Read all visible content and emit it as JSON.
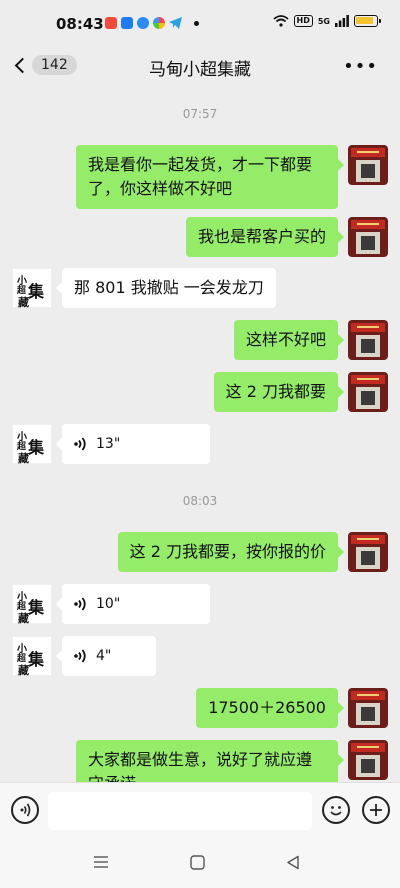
{
  "status_bar": {
    "time": "08:43",
    "hd_label": "HD",
    "signal_label": "5G",
    "icons": [
      "app-red-icon",
      "app-blue-icon",
      "app-shield-icon",
      "app-colorful-icon",
      "telegram-icon",
      "notification-dot-icon",
      "wifi-icon",
      "signal-icon",
      "battery-icon"
    ]
  },
  "header": {
    "unread_count": "142",
    "title": "马甸小超集藏",
    "more_icon": "more-icon"
  },
  "messages": {
    "time_1": "07:57",
    "msg_1": "我是看你一起发货，才一下都要了，你这样做不好吧",
    "msg_2": "我也是帮客户买的",
    "msg_3": "那 801 我撤贴 一会发龙刀",
    "msg_4": "这样不好吧",
    "msg_5": "这 2 刀我都要",
    "voice_1": "13\"",
    "time_2": "08:03",
    "msg_6": "这 2 刀我都要，按你报的价",
    "voice_2": "10\"",
    "voice_3": "4\"",
    "msg_7": "17500＋26500",
    "msg_8": "大家都是做生意，说好了就应遵守承诺"
  },
  "input_bar": {
    "voice_icon": "voice-mode-icon",
    "emoji_icon": "emoji-icon",
    "plus_icon": "plus-icon"
  },
  "colors": {
    "background": "#ededed",
    "outgoing_bubble": "#95ec69",
    "incoming_bubble": "#ffffff"
  }
}
